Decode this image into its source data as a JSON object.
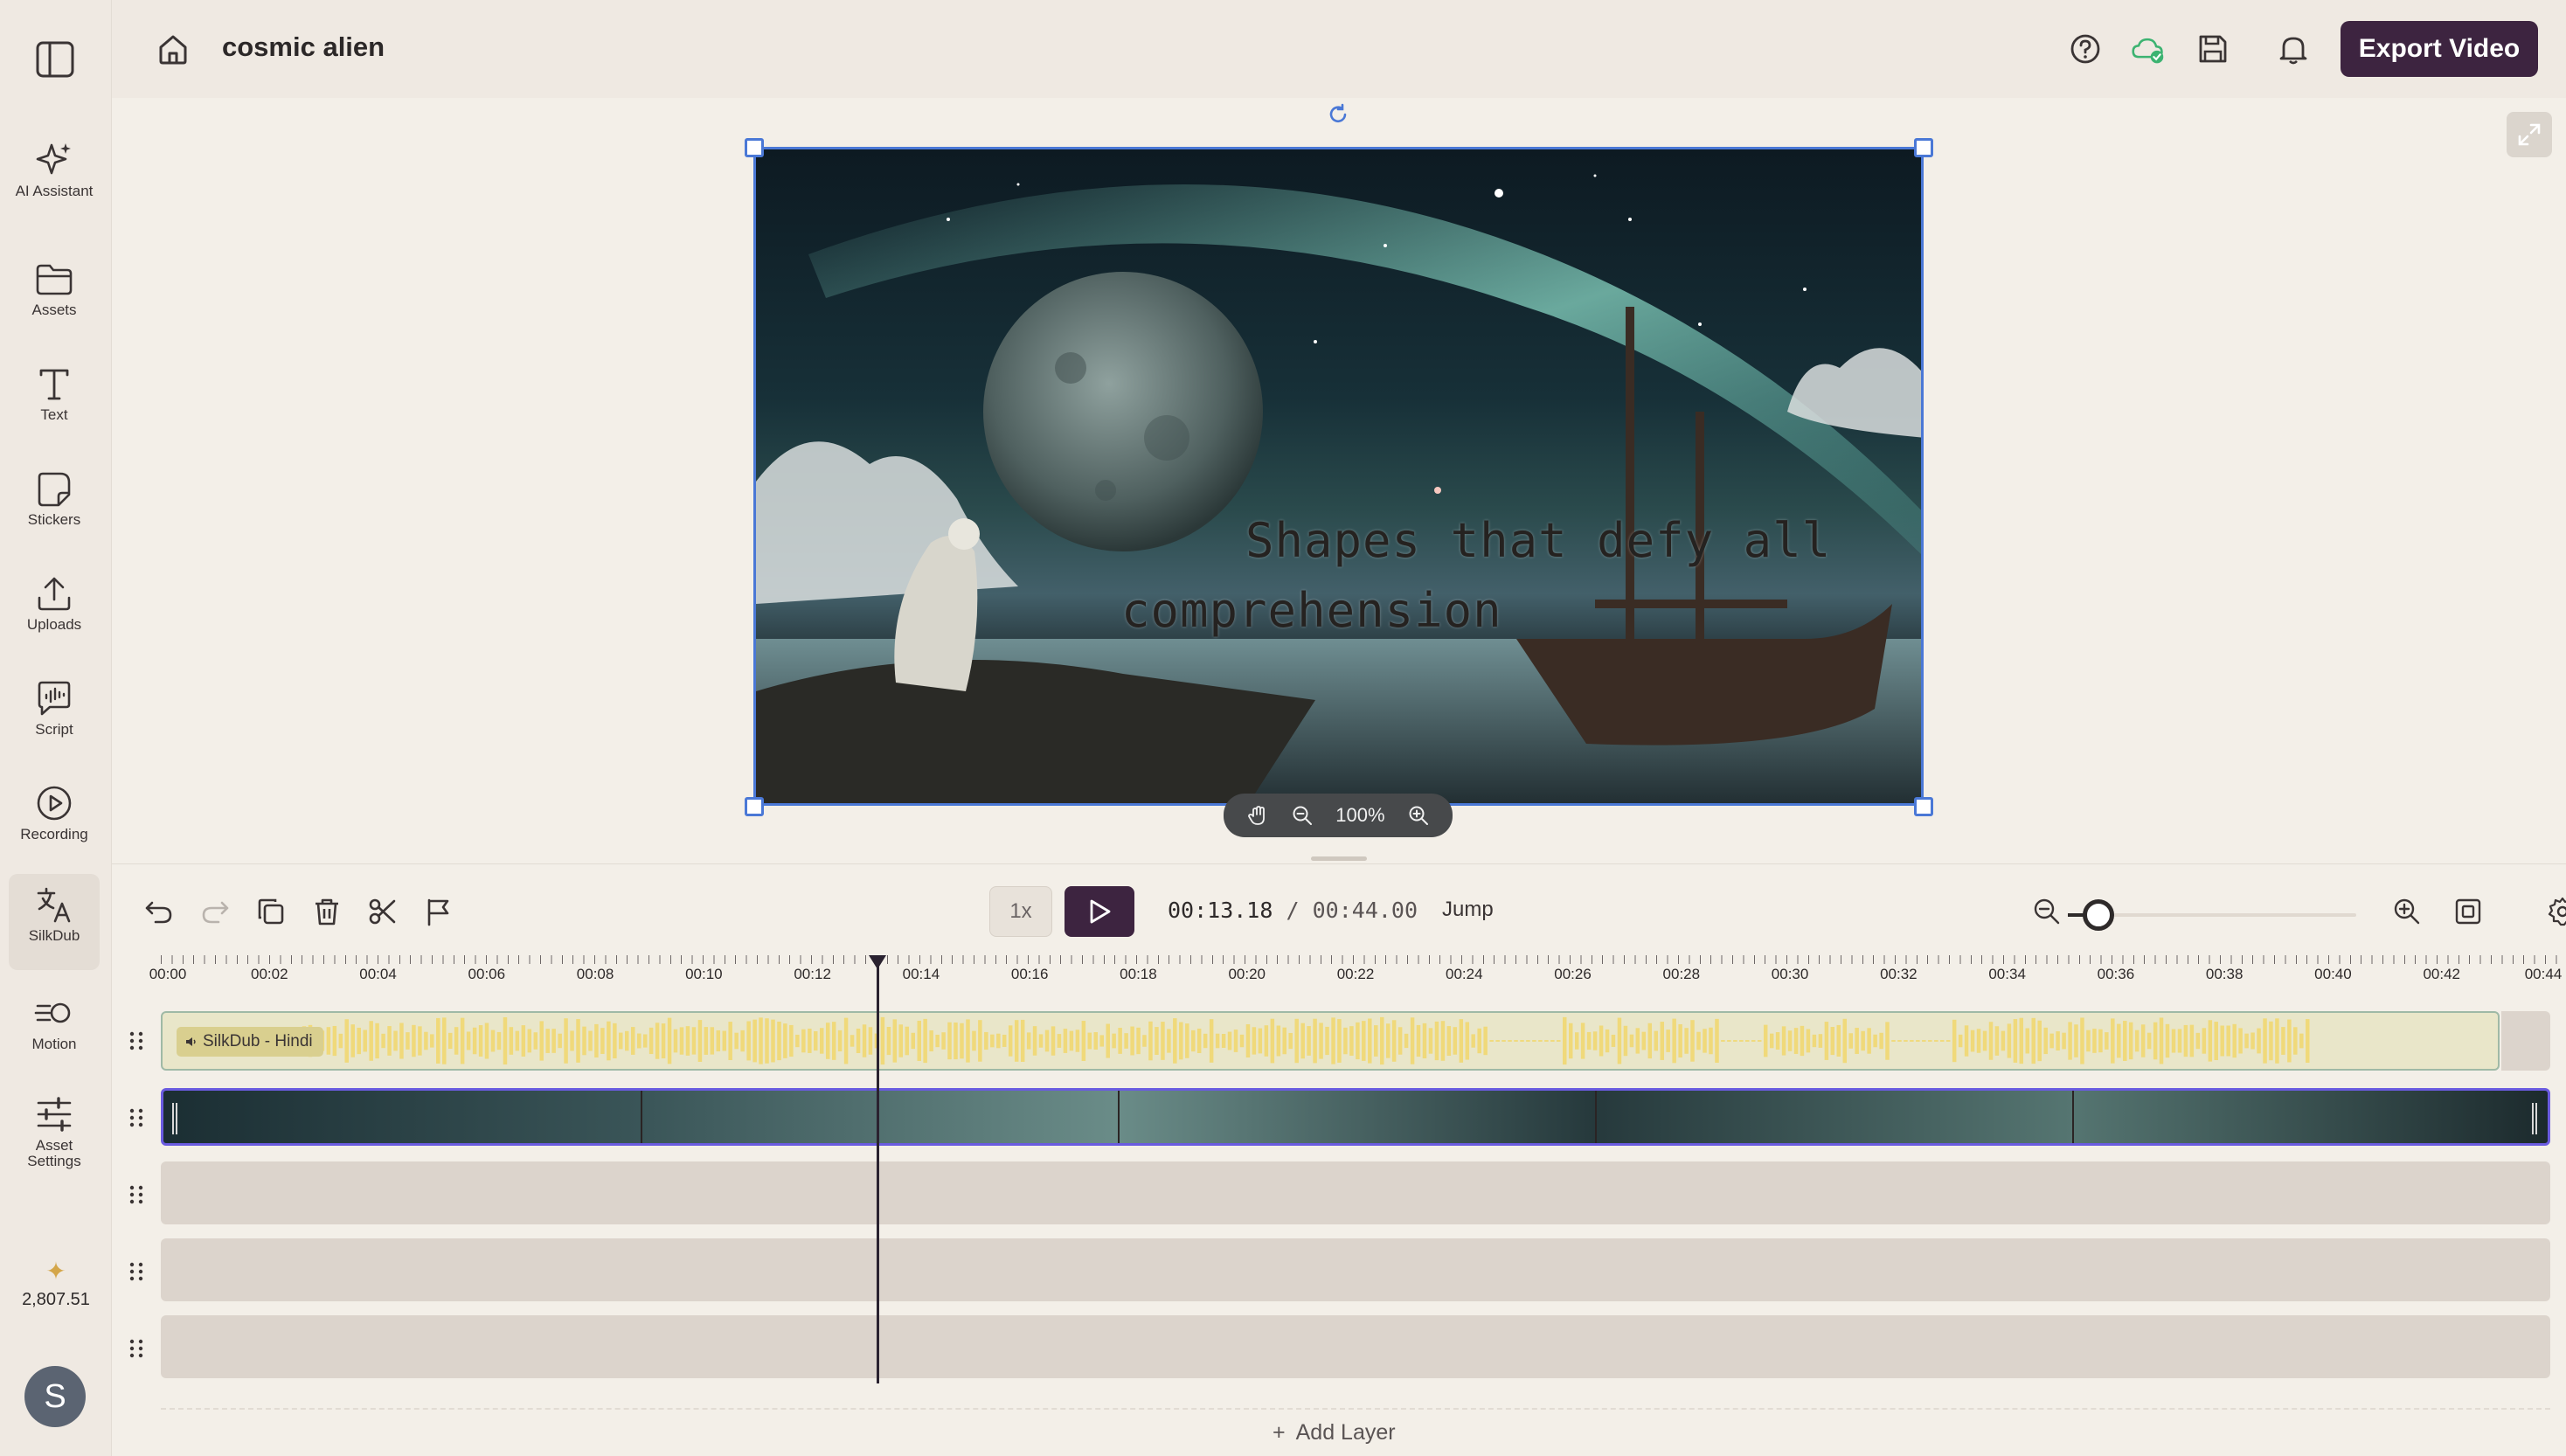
{
  "project": {
    "title": "cosmic alien"
  },
  "header": {
    "export_label": "Export Video"
  },
  "sidebar": {
    "items": [
      {
        "label": "AI Assistant",
        "icon": "sparkles-icon"
      },
      {
        "label": "Assets",
        "icon": "folder-icon"
      },
      {
        "label": "Text",
        "icon": "text-icon"
      },
      {
        "label": "Stickers",
        "icon": "sticker-icon"
      },
      {
        "label": "Uploads",
        "icon": "upload-icon"
      },
      {
        "label": "Script",
        "icon": "script-icon"
      },
      {
        "label": "Recording",
        "icon": "record-icon"
      },
      {
        "label": "SilkDub",
        "icon": "translate-icon",
        "active": true
      },
      {
        "label": "Motion",
        "icon": "motion-icon"
      },
      {
        "label": "Asset Settings",
        "icon": "sliders-icon"
      }
    ],
    "credits": "2,807.51",
    "avatar_initial": "S"
  },
  "canvas": {
    "caption_line1": "Shapes that defy all",
    "caption_line2": "comprehension",
    "zoom_level": "100%"
  },
  "timeline": {
    "speed": "1x",
    "current_time": "00:13.18",
    "separator": "/",
    "total_time": "00:44.00",
    "jump_label": "Jump",
    "zoom_slider_value": 0.05,
    "playhead_time_seconds": 13.18,
    "ruler_labels": [
      "00:00",
      "00:02",
      "00:04",
      "00:06",
      "00:08",
      "00:10",
      "00:12",
      "00:14",
      "00:16",
      "00:18",
      "00:20",
      "00:22",
      "00:24",
      "00:26",
      "00:28",
      "00:30",
      "00:32",
      "00:34",
      "00:36",
      "00:38",
      "00:40",
      "00:42",
      "00:44"
    ],
    "audio_track_label": "SilkDub - Hindi",
    "add_layer_label": "Add Layer"
  },
  "colors": {
    "accent": "#3d2440",
    "selection": "#4a78d6",
    "video_track_border": "#6a5be0",
    "audio_wave": "#f0d97a",
    "cloud_ok": "#3cb371"
  }
}
